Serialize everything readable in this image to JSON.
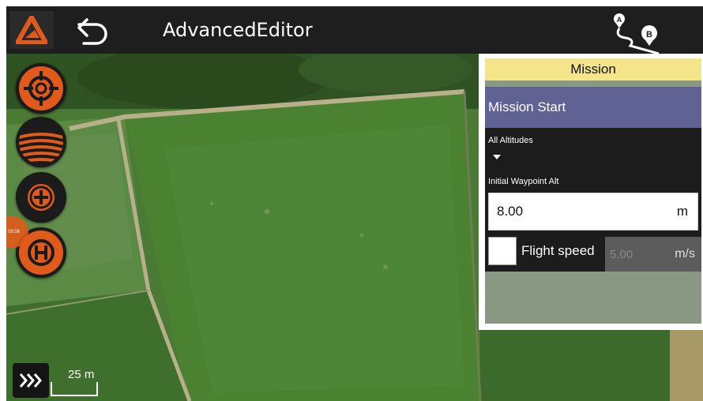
{
  "app": {
    "title": "AdvancedEditor"
  },
  "icons": {
    "logo": "app-logo",
    "back": "back-arrow",
    "route": "route-a-to-b",
    "tools": [
      "crosshair-target",
      "field-survey",
      "add-plus",
      "helipad-home"
    ],
    "layers": "chevrons-right"
  },
  "map": {
    "badge_text": "08:06",
    "scale_label": "25 m"
  },
  "route": {
    "point_a": "A",
    "point_b": "B"
  },
  "mission_panel": {
    "header": "Mission",
    "section": "Mission Start",
    "all_altitudes_label": "All Altitudes",
    "initial_waypoint_alt_label": "Initial Waypoint Alt",
    "initial_waypoint_alt_value": "8.00",
    "initial_waypoint_alt_unit": "m",
    "flight_speed_label": "Flight speed",
    "flight_speed_value": "5.00",
    "flight_speed_unit": "m/s",
    "flight_speed_checked": false
  },
  "colors": {
    "accent": "#e05a1c",
    "header": "#f4e58a",
    "mission_start": "#606293",
    "topbar": "#1e1e1e"
  }
}
